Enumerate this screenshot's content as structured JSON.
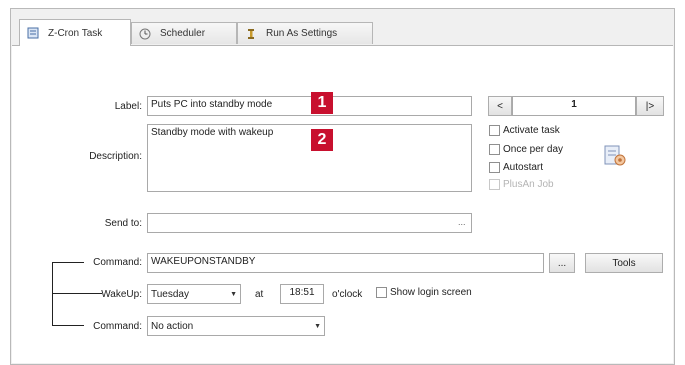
{
  "tabs": [
    {
      "label": "Z-Cron Task",
      "icon": "task-icon"
    },
    {
      "label": "Scheduler",
      "icon": "scheduler-icon"
    },
    {
      "label": "Run As Settings",
      "icon": "user-icon"
    }
  ],
  "form": {
    "label_caption": "Label:",
    "label_value": "Puts PC into standby mode",
    "description_caption": "Description:",
    "description_value": "Standby mode with wakeup",
    "sendto_caption": "Send to:",
    "sendto_value": "",
    "sendto_browse": "...",
    "nav_prev": "<",
    "nav_counter": "1",
    "nav_next": "|>",
    "checkboxes": {
      "activate": "Activate task",
      "once": "Once per day",
      "autostart": "Autostart",
      "plus_job": "PlusAn Job"
    },
    "command1_caption": "Command:",
    "command1_value": "WAKEUPONSTANDBY",
    "command1_browse": "...",
    "tools_label": "Tools",
    "wakeup_caption": "WakeUp:",
    "wakeup_day": "Tuesday",
    "at_label": "at",
    "time_value": "18:51",
    "oclock_label": "o'clock",
    "show_login_label": "Show login screen",
    "command2_caption": "Command:",
    "command2_value": "No action"
  },
  "badges": [
    "1",
    "2"
  ],
  "colors": {
    "badge": "#c8102e"
  }
}
